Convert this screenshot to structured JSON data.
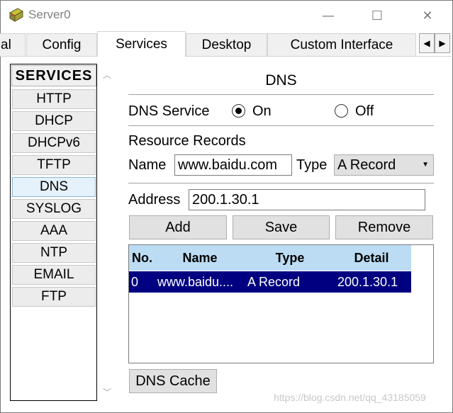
{
  "window": {
    "title": "Server0",
    "minimize_glyph": "—",
    "maximize_glyph": "☐",
    "close_glyph": "✕",
    "icon": "server-icon"
  },
  "tabs": [
    {
      "label": "al",
      "active": false
    },
    {
      "label": "Config",
      "active": false
    },
    {
      "label": "Services",
      "active": true
    },
    {
      "label": "Desktop",
      "active": false
    },
    {
      "label": "Custom Interface",
      "active": false
    }
  ],
  "tab_scroll": {
    "left": "◀",
    "right": "▶"
  },
  "services": {
    "heading": "SERVICES",
    "items": [
      "HTTP",
      "DHCP",
      "DHCPv6",
      "TFTP",
      "DNS",
      "SYSLOG",
      "AAA",
      "NTP",
      "EMAIL",
      "FTP"
    ],
    "selected": "DNS",
    "scroll_up": "︿",
    "scroll_down": "﹀"
  },
  "dns": {
    "heading": "DNS",
    "service_label": "DNS Service",
    "on_label": "On",
    "off_label": "Off",
    "service_on": true,
    "resource_records_label": "Resource Records",
    "name_label": "Name",
    "name_value": "www.baidu.com",
    "type_label": "Type",
    "type_value": "A Record",
    "address_label": "Address",
    "address_value": "200.1.30.1",
    "add_button": "Add",
    "save_button": "Save",
    "remove_button": "Remove",
    "cache_button": "DNS Cache"
  },
  "records_table": {
    "columns": [
      "No.",
      "Name",
      "Type",
      "Detail"
    ],
    "rows": [
      {
        "no": "0",
        "name": "www.baidu....",
        "type": "A Record",
        "detail": "200.1.30.1"
      }
    ]
  },
  "watermark": "https://blog.csdn.net/qq_43185059",
  "colors": {
    "selected_row": "#000080",
    "table_header": "#bcdcf4",
    "selected_service": "#e5f1fb"
  }
}
